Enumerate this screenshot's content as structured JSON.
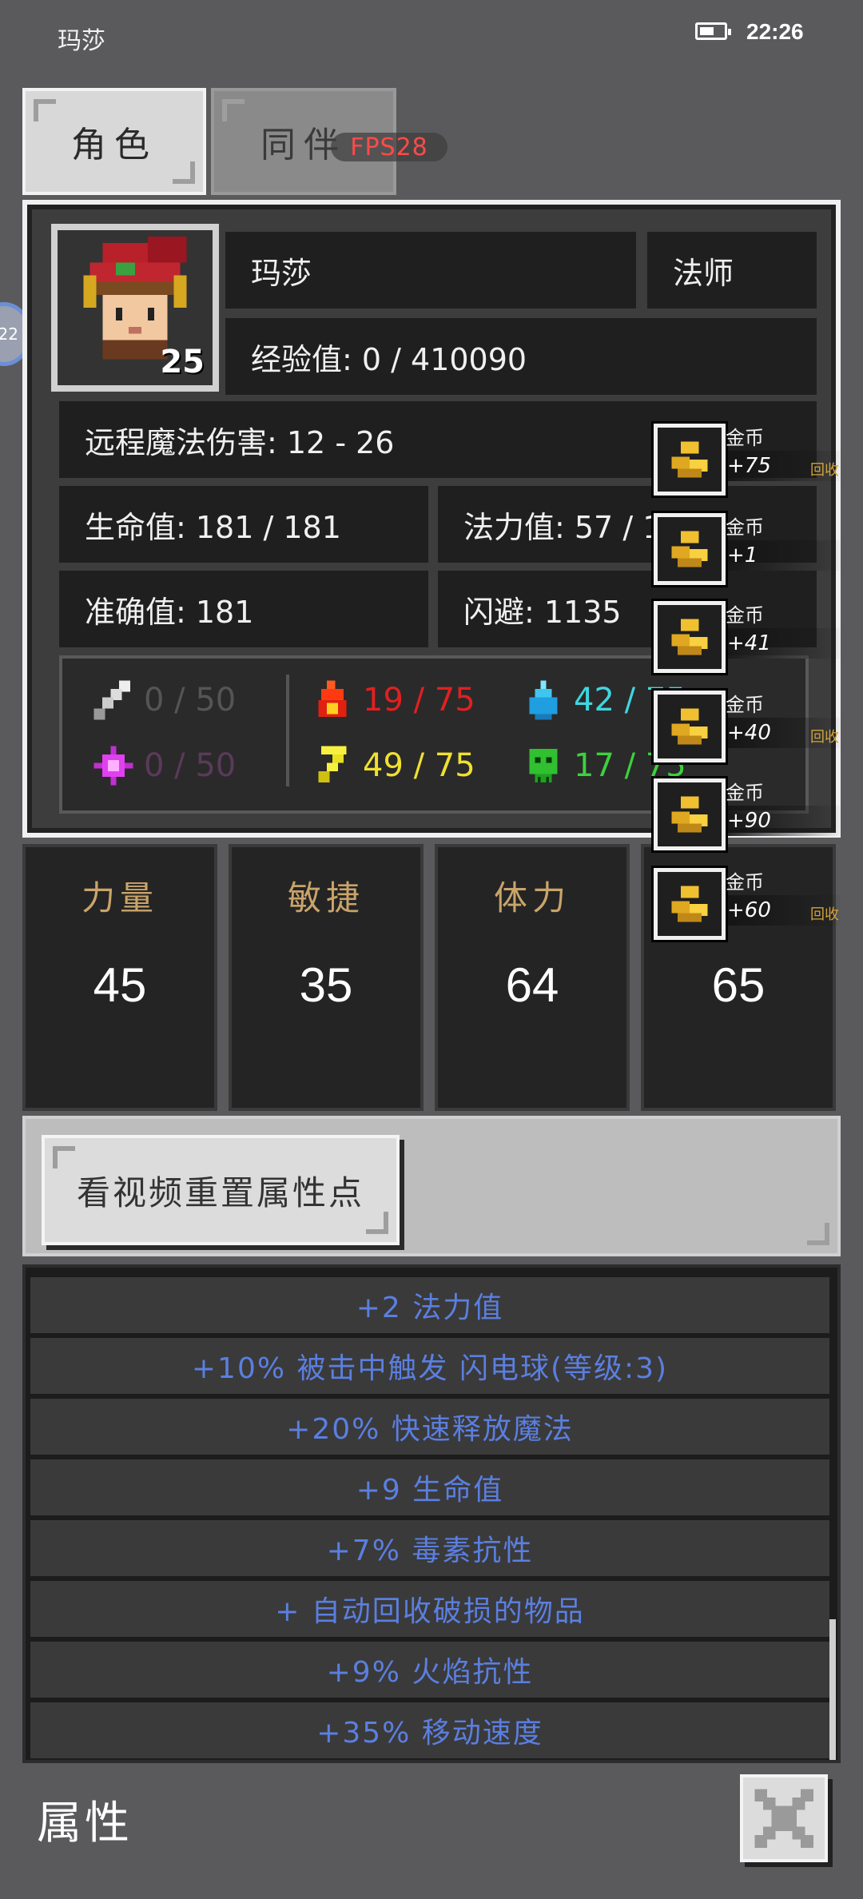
{
  "status_bar": {
    "title": "玛莎",
    "time": "22:26",
    "battery_level": 0.6
  },
  "tabs": [
    {
      "label": "角色",
      "active": true
    },
    {
      "label": "同伴",
      "active": false
    }
  ],
  "fps": "FPS28",
  "side_tab": "22",
  "character": {
    "level": "25",
    "name": "玛莎",
    "class": "法师",
    "experience": "经验值: 0 / 410090",
    "damage": "远程魔法伤害: 12 - 26",
    "hp": "生命值: 181 / 181",
    "mp": "法力值: 57 / 1",
    "accuracy": "准确值: 181",
    "dodge": "闪避: 1135"
  },
  "resistances": {
    "physical": {
      "value": "0 / 50",
      "color": "#555555"
    },
    "fire": {
      "value": "19 / 75",
      "color": "#e02020"
    },
    "cold": {
      "value": "42 / 75",
      "color": "#3fd6e0"
    },
    "magic": {
      "value": "0 / 50",
      "color": "#5a3a5a"
    },
    "lightning": {
      "value": "49 / 75",
      "color": "#f0e030"
    },
    "poison": {
      "value": "17 / 75",
      "color": "#3cd23c"
    }
  },
  "attributes": [
    {
      "label": "力量",
      "value": "45"
    },
    {
      "label": "敏捷",
      "value": "35"
    },
    {
      "label": "体力",
      "value": "64"
    },
    {
      "label": "",
      "value": "65"
    }
  ],
  "reset_button": "看视频重置属性点",
  "bonuses": [
    "+2 法力值",
    "+10% 被击中触发 闪电球(等级:3)",
    "+20% 快速释放魔法",
    "+9 生命值",
    "+7% 毒素抗性",
    "+ 自动回收破损的物品",
    "+9% 火焰抗性",
    "+35% 移动速度"
  ],
  "coin_notifications": [
    {
      "name": "金币",
      "amount": "+75",
      "recycle": "回收"
    },
    {
      "name": "金币",
      "amount": "+1",
      "recycle": ""
    },
    {
      "name": "金币",
      "amount": "+41",
      "recycle": ""
    },
    {
      "name": "金币",
      "amount": "+40",
      "recycle": "回收"
    },
    {
      "name": "金币",
      "amount": "+90",
      "recycle": ""
    },
    {
      "name": "金币",
      "amount": "+60",
      "recycle": "回收"
    }
  ],
  "bottom": {
    "title": "属性"
  }
}
